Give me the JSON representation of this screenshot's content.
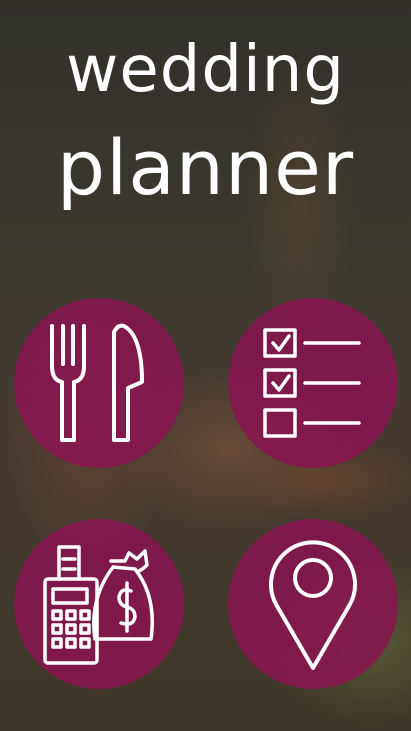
{
  "app": {
    "title_line1": "wedding",
    "title_line2": "planner"
  },
  "menu": [
    {
      "icon": "fork-knife-icon"
    },
    {
      "icon": "checklist-icon"
    },
    {
      "icon": "payment-terminal-money-bag-icon"
    },
    {
      "icon": "map-pin-icon"
    }
  ],
  "colors": {
    "tile": "#8c1252",
    "icon": "#ffffff",
    "text": "#ffffff"
  }
}
